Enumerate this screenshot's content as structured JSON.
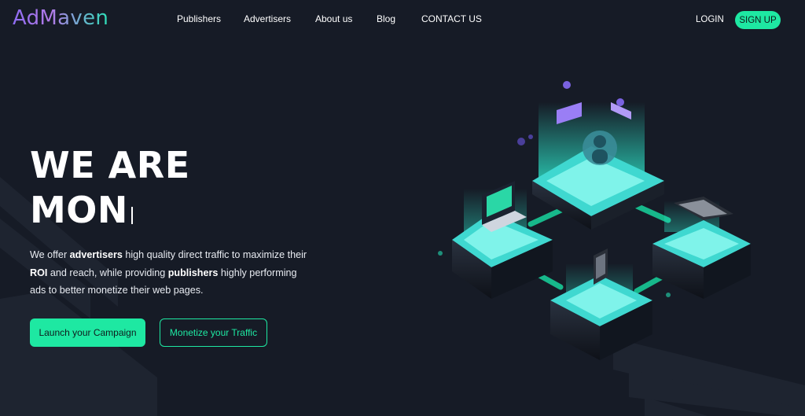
{
  "brand": {
    "name": "AdMaven"
  },
  "nav": {
    "items": [
      {
        "label": "Publishers"
      },
      {
        "label": "Advertisers"
      },
      {
        "label": "About us"
      },
      {
        "label": "Blog"
      },
      {
        "label": "CONTACT US"
      }
    ],
    "login": "LOGIN",
    "signup": "SIGN UP"
  },
  "hero": {
    "title_line1": "WE ARE",
    "title_line2": "MON",
    "description": {
      "p1": "We offer ",
      "b1": "advertisers",
      "p2": " high quality direct traffic to maximize their ",
      "b2": "ROI",
      "p3": " and reach, while providing ",
      "b3": "publishers",
      "p4": " highly performing ads to better monetize their web pages."
    },
    "primary_button": "Launch your Campaign",
    "secondary_button": "Monetize your Traffic"
  },
  "colors": {
    "background": "#161b26",
    "accent": "#1ee8a2",
    "logo_purple": "#8e6cf2"
  },
  "icons": {
    "illustration": "network-isometric-illustration"
  }
}
